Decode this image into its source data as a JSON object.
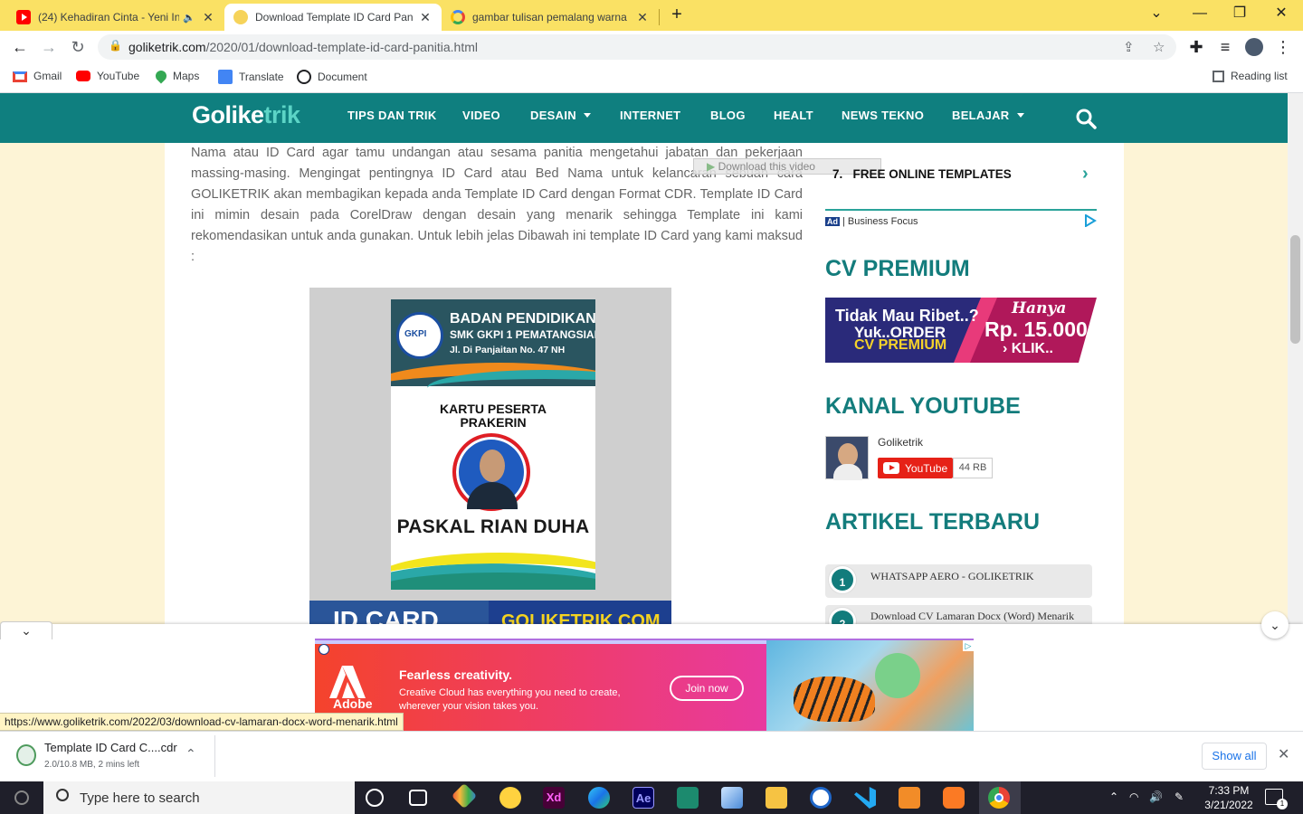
{
  "browser": {
    "tabs": [
      {
        "title": "(24) Kehadiran Cinta - Yeni In",
        "favicon": "youtube-icon",
        "muted_icon": "speaker-icon",
        "color": "#ff0000"
      },
      {
        "title": "Download Template ID Card Pani",
        "favicon": "golike-icon",
        "active": true
      },
      {
        "title": "gambar tulisan pemalang warna",
        "favicon": "google-icon"
      }
    ],
    "new_tab_label": "+",
    "address": {
      "host": "goliketrik.com",
      "path": "/2020/01/download-template-id-card-panitia.html"
    },
    "bookmarks": [
      {
        "label": "Gmail",
        "icon": "gmail-icon"
      },
      {
        "label": "YouTube",
        "icon": "youtube-icon"
      },
      {
        "label": "Maps",
        "icon": "maps-icon"
      },
      {
        "label": "Translate",
        "icon": "translate-icon"
      },
      {
        "label": "Document",
        "icon": "document-icon"
      }
    ],
    "reading_list": "Reading list"
  },
  "site": {
    "logo_prefix": "Golike",
    "logo_suffix": "trik",
    "nav": [
      "TIPS DAN TRIK",
      "VIDEO",
      "DESAIN",
      "INTERNET",
      "BLOG",
      "HEALT",
      "NEWS TEKNO",
      "BELAJAR"
    ],
    "accent": "#0f7f7f"
  },
  "article": {
    "paragraph": "Nama atau ID Card agar tamu undangan atau sesama panitia mengetahui jabatan dan pekerjaan massing-masing. Mengingat pentingnya ID Card atau Bed Nama untuk kelancaran sebuah cara GOLIKETRIK akan membagikan kepada anda Template ID Card dengan Format CDR. Template ID Card ini mimin desain pada CorelDraw dengan desain yang menarik sehingga Template ini kami rekomendasikan untuk anda gunakan.  Untuk lebih jelas Dibawah ini template ID Card yang kami maksud :",
    "download_video": "Download this video",
    "card": {
      "school_line1": "BADAN PENDIDIKAN",
      "school_line2": "SMK GKPI 1 PEMATANGSIANTAR",
      "school_line3": "Jl. Di Panjaitan No. 47 NH",
      "emblem": "GKPI",
      "kartu_line1": "KARTU PESERTA",
      "kartu_line2": "PRAKERIN",
      "name": "PASKAL RIAN DUHA",
      "banner_left": "ID CARD",
      "banner_right": "GOLIKETRIK.COM"
    }
  },
  "sidebar": {
    "item7_num": "7.",
    "item7_label": "FREE ONLINE TEMPLATES",
    "ad_badge": "Ad",
    "ad_source": "| Business Focus",
    "cv_title": "CV PREMIUM",
    "cv_banner": {
      "l1": "Tidak Mau Ribet..?",
      "l2": "Yuk..ORDER",
      "l3": "CV PREMIUM",
      "r1": "Hanya",
      "r2": "Rp. 15.000",
      "r3": "KLIK.."
    },
    "yt_title": "KANAL YOUTUBE",
    "yt_channel": "Goliketrik",
    "yt_button": "YouTube",
    "yt_count": "44 RB",
    "articles_title": "ARTIKEL TERBARU",
    "articles": [
      {
        "num": "1",
        "title": "WHATSAPP AERO - GOLIKETRIK"
      },
      {
        "num": "2",
        "title": "Download CV Lamaran Docx (Word) Menarik Dan Simpel Mudah Diedit"
      }
    ]
  },
  "ad": {
    "brand": "Adobe",
    "headline": "Fearless creativity.",
    "body": "Creative Cloud has everything you need to create, wherever your vision takes you.",
    "cta": "Join now"
  },
  "status_url": "https://www.goliketrik.com/2022/03/download-cv-lamaran-docx-word-menarik.html",
  "download": {
    "filename": "Template ID Card C....cdr",
    "status": "2.0/10.8 MB, 2 mins left",
    "show_all": "Show all"
  },
  "taskbar": {
    "search_placeholder": "Type here to search",
    "time": "7:33 PM",
    "date": "3/21/2022",
    "notifications": "1"
  }
}
